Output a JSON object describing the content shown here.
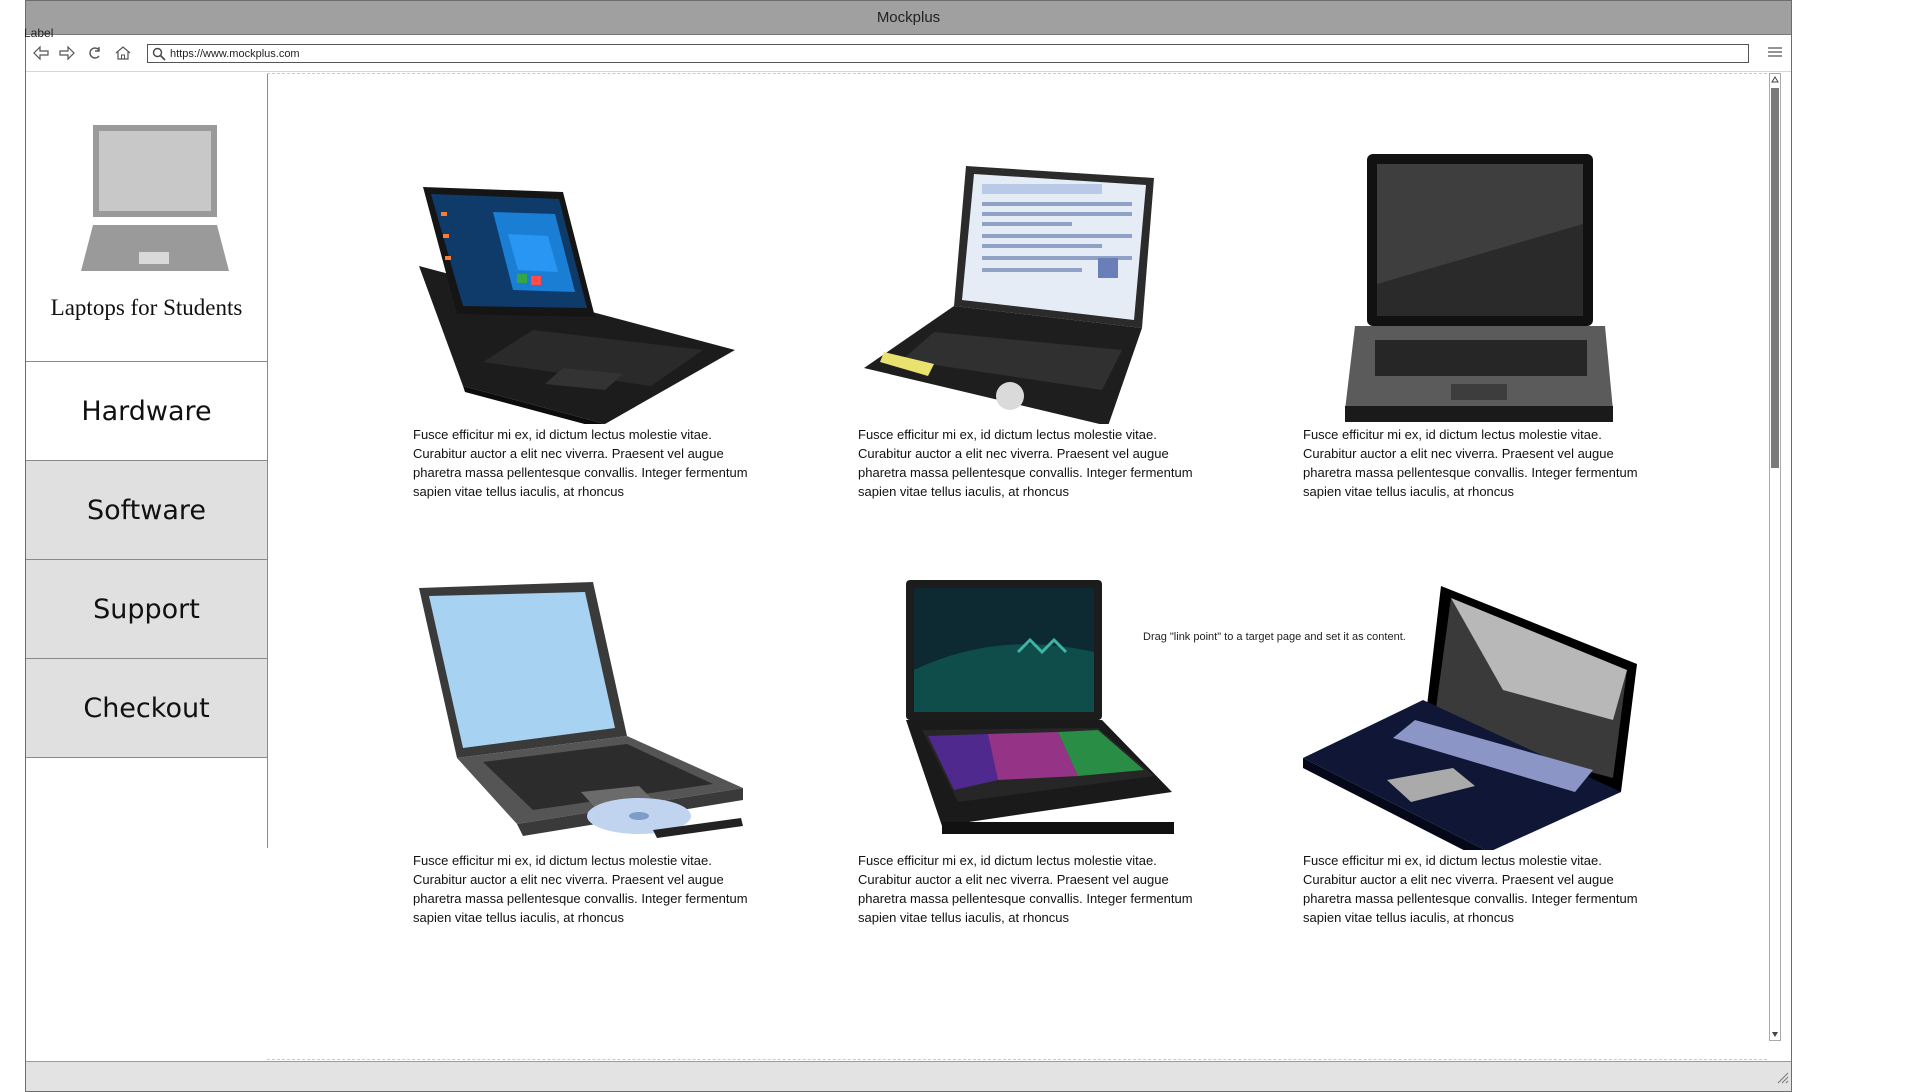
{
  "corner_label": "Label",
  "window": {
    "title": "Mockplus"
  },
  "browser": {
    "url": "https://www.mockplus.com",
    "icons": [
      "back-arrow-icon",
      "forward-arrow-icon",
      "refresh-icon",
      "home-icon",
      "search-icon",
      "hamburger-menu-icon"
    ]
  },
  "sidebar": {
    "brand": "Laptops for Students",
    "logo_icon": "laptop-icon",
    "items": [
      {
        "label": "Hardware",
        "state": "active"
      },
      {
        "label": "Software",
        "state": "inactive"
      },
      {
        "label": "Support",
        "state": "inactive"
      },
      {
        "label": "Checkout",
        "state": "inactive"
      }
    ]
  },
  "products": [
    {
      "image": "laptop-windows-icon",
      "description": "Fusce efficitur mi ex, id dictum lectus molestie vitae. Curabitur auctor a elit nec viverra. Praesent vel augue pharetra massa pellentesque convallis. Integer fermentum sapien vitae tellus iaculis, at rhoncus"
    },
    {
      "image": "laptop-browser-icon",
      "description": "Fusce efficitur mi ex, id dictum lectus molestie vitae. Curabitur auctor a elit nec viverra. Praesent vel augue pharetra massa pellentesque convallis. Integer fermentum sapien vitae tellus iaculis, at rhoncus"
    },
    {
      "image": "laptop-front-icon",
      "description": "Fusce efficitur mi ex, id dictum lectus molestie vitae. Curabitur auctor a elit nec viverra. Praesent vel augue pharetra massa pellentesque convallis. Integer fermentum sapien vitae tellus iaculis, at rhoncus"
    },
    {
      "image": "laptop-cd-drive-icon",
      "description": "Fusce efficitur mi ex, id dictum lectus molestie vitae. Curabitur auctor a elit nec viverra. Praesent vel augue pharetra massa pellentesque convallis. Integer fermentum sapien vitae tellus iaculis, at rhoncus"
    },
    {
      "image": "laptop-gaming-icon",
      "description": "Fusce efficitur mi ex, id dictum lectus molestie vitae. Curabitur auctor a elit nec viverra. Praesent vel augue pharetra massa pellentesque convallis. Integer fermentum sapien vitae tellus iaculis, at rhoncus"
    },
    {
      "image": "laptop-clipart-icon",
      "description": "Fusce efficitur mi ex, id dictum lectus molestie vitae. Curabitur auctor a elit nec viverra. Praesent vel augue pharetra massa pellentesque convallis. Integer fermentum sapien vitae tellus iaculis, at rhoncus"
    }
  ],
  "hint": "Drag \"link point\" to a target page and set it as content.",
  "colors": {
    "titlebar": "#a0a0a0",
    "nav_inactive": "#e0e0e0",
    "scroll_thumb": "#7a7a7a",
    "statusbar": "#e3e3e3"
  }
}
